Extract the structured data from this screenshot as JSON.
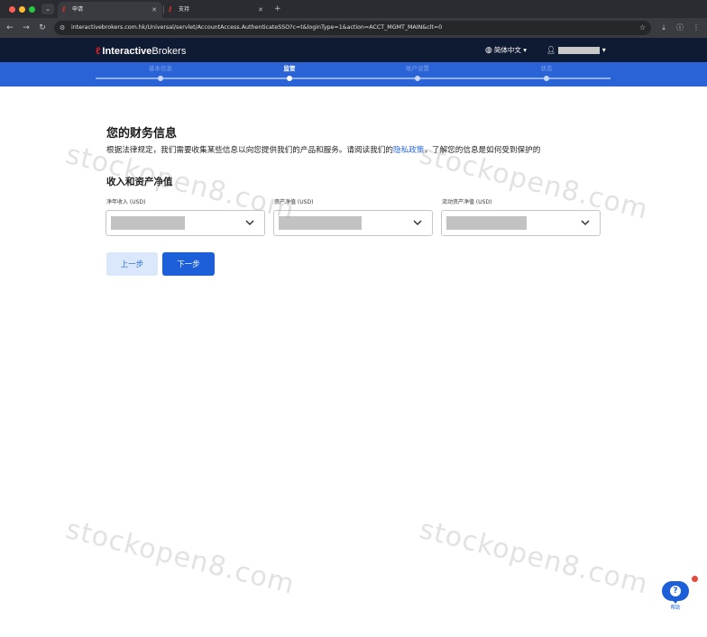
{
  "browser": {
    "tabs": [
      {
        "label": "申请",
        "active": true
      },
      {
        "label": "支持",
        "active": false
      }
    ],
    "url": "interactivebrokers.com.hk/Universal/servlet/AccountAccess.AuthenticateSSO?c=t&loginType=1&action=ACCT_MGMT_MAIN&clt=0"
  },
  "header": {
    "brand_bold": "Interactive",
    "brand_light": "Brokers",
    "language": "简体中文"
  },
  "steps": [
    {
      "label": "基本信息",
      "current": false
    },
    {
      "label": "监管",
      "current": true
    },
    {
      "label": "账户设置",
      "current": false
    },
    {
      "label": "状态",
      "current": false
    }
  ],
  "main": {
    "title": "您的财务信息",
    "intro_before": "根据法律规定，我们需要收集某些信息以向您提供我们的产品和服务。请阅读我们的",
    "intro_link": "隐私政策",
    "intro_after": "，了解您的信息是如何受到保护的",
    "section_title": "收入和资产净值",
    "fields": [
      {
        "label": "净年收入 (USD)"
      },
      {
        "label": "资产净值 (USD)"
      },
      {
        "label": "流动资产净值 (USD)"
      }
    ],
    "prev_label": "上一步",
    "next_label": "下一步"
  },
  "watermark": "stockopen8.com",
  "help": {
    "label": "帮助"
  },
  "colors": {
    "header_bg": "#0f1a33",
    "steps_bg": "#2a63d6",
    "primary": "#1c5fd8",
    "brand_red": "#d81f26"
  }
}
